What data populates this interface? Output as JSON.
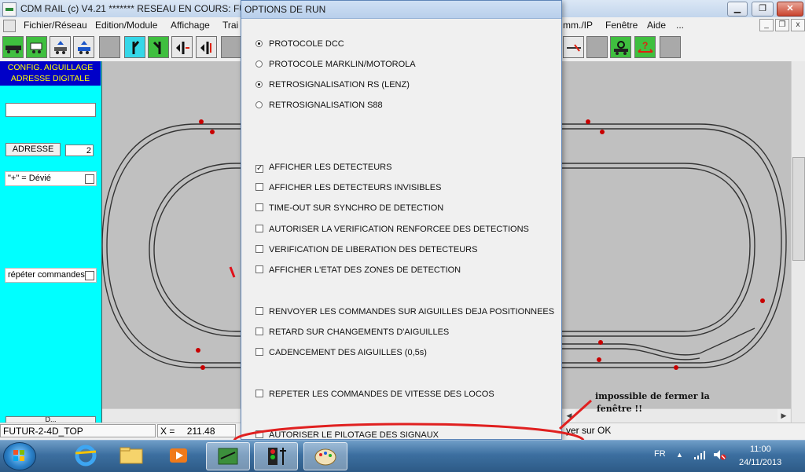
{
  "window": {
    "title": "CDM RAIL (c) V4.21     ******* RESEAU EN COURS: FUT",
    "controls": {
      "minimize": "▁",
      "maximize": "❐",
      "close": "✕"
    }
  },
  "menubar": {
    "left_items": [
      "Fichier/Réseau",
      "Edition/Module",
      "Affichage",
      "Trai"
    ],
    "right_items": [
      "mm./IP",
      "Fenêtre",
      "Aide",
      "..."
    ]
  },
  "left_panel": {
    "title_line1": "CONFIG. AIGUILLAGE",
    "title_line2": "ADRESSE DIGITALE",
    "adresse_button": "ADRESSE",
    "adresse_value": "2",
    "devie_label": "\"+\" = Dévié",
    "repeter_label": "répéter commandes",
    "bottom_button_partial": "D..."
  },
  "dialog": {
    "title": "OPTIONS DE RUN",
    "radios": [
      {
        "label": "PROTOCOLE DCC",
        "checked": true
      },
      {
        "label": "PROTOCOLE MARKLIN/MOTOROLA",
        "checked": false
      },
      {
        "label": "RETROSIGNALISATION RS (LENZ)",
        "checked": true
      },
      {
        "label": "RETROSIGNALISATION S88",
        "checked": false
      }
    ],
    "checks_group1": [
      {
        "label": "AFFICHER LES DETECTEURS",
        "checked": true
      },
      {
        "label": "AFFICHER LES DETECTEURS INVISIBLES",
        "checked": false
      },
      {
        "label": "TIME-OUT SUR SYNCHRO DE DETECTION",
        "checked": false
      },
      {
        "label": "AUTORISER LA VERIFICATION RENFORCEE DES DETECTIONS",
        "checked": false
      },
      {
        "label": "VERIFICATION DE LIBERATION DES DETECTEURS",
        "checked": false
      },
      {
        "label": "AFFICHER L'ETAT DES ZONES DE DETECTION",
        "checked": false
      }
    ],
    "checks_group2": [
      {
        "label": "RENVOYER LES COMMANDES SUR AIGUILLES DEJA POSITIONNEES",
        "checked": false
      },
      {
        "label": "RETARD SUR CHANGEMENTS D'AIGUILLES",
        "checked": false
      },
      {
        "label": "CADENCEMENT DES AIGUILLES (0,5s)",
        "checked": false
      }
    ],
    "checks_group3": [
      {
        "label": "REPETER LES COMMANDES DE VITESSE DES LOCOS",
        "checked": false
      }
    ],
    "checks_group4": [
      {
        "label": "AUTORISER LE PILOTAGE DES SIGNAUX",
        "checked": false
      }
    ]
  },
  "statusbar": {
    "module": "FUTUR-2-4D_TOP",
    "x_label": "X =",
    "x_value": "211.48",
    "hint": "yer sur OK"
  },
  "annotation": {
    "line1": "impossible de fermer la",
    "line2": "fenêtre !!",
    "color": "#e02020"
  },
  "taskbar": {
    "lang": "FR",
    "time": "11:00",
    "date": "24/11/2013"
  },
  "colors": {
    "panel_cyan": "#00ffff",
    "panel_title_bg": "#0000c8",
    "panel_title_fg": "#ffff00",
    "canvas_gray": "#c0c0c0"
  }
}
